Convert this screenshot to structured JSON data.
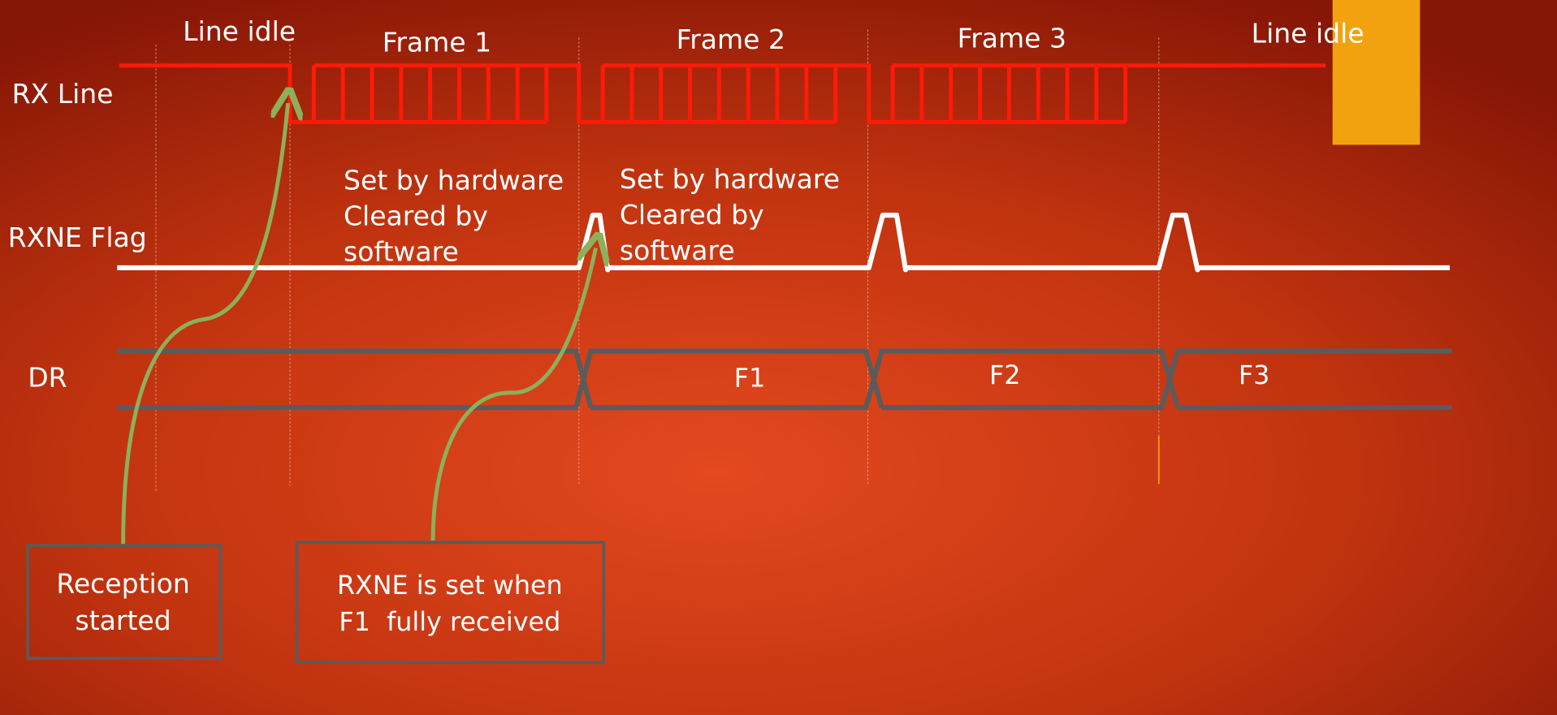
{
  "signals": {
    "rx_line": "RX Line",
    "rxne_flag": "RXNE Flag",
    "dr": "DR"
  },
  "phases": {
    "idle_start": "Line idle",
    "frame1": "Frame 1",
    "frame2": "Frame 2",
    "frame3": "Frame 3",
    "idle_end": "Line idle"
  },
  "notes": {
    "note1": [
      "Set by hardware",
      "Cleared by",
      "software"
    ],
    "note2": [
      "Set by hardware",
      "Cleared by",
      "software"
    ]
  },
  "dr_values": [
    "F1",
    "F2",
    "F3"
  ],
  "callouts": {
    "reception": [
      "Reception",
      "started"
    ],
    "rxne": [
      "RXNE is set when",
      "F1  fully received"
    ]
  },
  "colors": {
    "rx_line": "#ff1a0a",
    "rxne_line": "#ffffff",
    "dr_bus": "#5b5b5b",
    "arrow": "#8db05a",
    "highlight": "#f2a20e",
    "background_center": "#e4491f",
    "background_edge": "#8a1808"
  }
}
